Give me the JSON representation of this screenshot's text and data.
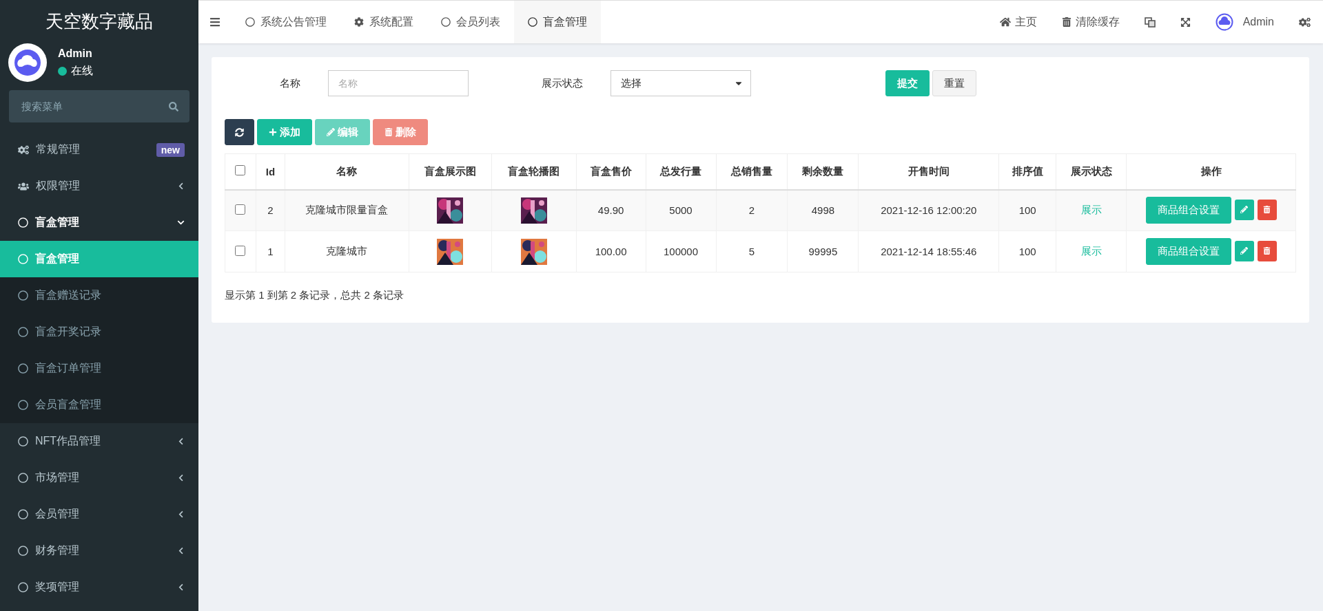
{
  "brand": "天空数字藏品",
  "user": {
    "name": "Admin",
    "status": "在线",
    "online": true
  },
  "menu_search": {
    "placeholder": "搜索菜单"
  },
  "menu": [
    {
      "label": "常规管理",
      "kind": "gears",
      "badge": "new"
    },
    {
      "label": "权限管理",
      "kind": "users",
      "expanded": false
    },
    {
      "label": "盲盒管理",
      "kind": "circle",
      "expanded": true,
      "children": [
        {
          "label": "盲盒管理",
          "selected": true
        },
        {
          "label": "盲盒赠送记录",
          "selected": false
        },
        {
          "label": "盲盒开奖记录",
          "selected": false
        },
        {
          "label": "盲盒订单管理",
          "selected": false
        },
        {
          "label": "会员盲盒管理",
          "selected": false
        }
      ]
    },
    {
      "label": "NFT作品管理",
      "kind": "circle",
      "expanded": false
    },
    {
      "label": "市场管理",
      "kind": "circle",
      "expanded": false
    },
    {
      "label": "会员管理",
      "kind": "circle",
      "expanded": false
    },
    {
      "label": "财务管理",
      "kind": "circle",
      "expanded": false
    },
    {
      "label": "奖项管理",
      "kind": "circle",
      "expanded": false
    }
  ],
  "tabs": [
    {
      "label": "系统公告管理",
      "kind": "circle",
      "selected": false
    },
    {
      "label": "系统配置",
      "kind": "gear",
      "selected": false
    },
    {
      "label": "会员列表",
      "kind": "circle",
      "selected": false
    },
    {
      "label": "盲盒管理",
      "kind": "circle",
      "selected": true
    }
  ],
  "top_actions": [
    {
      "kind": "home",
      "label": "主页"
    },
    {
      "kind": "trash",
      "label": "清除缓存"
    },
    {
      "kind": "translate"
    },
    {
      "kind": "fullscreen"
    },
    {
      "kind": "user",
      "label": "Admin"
    },
    {
      "kind": "settings"
    }
  ],
  "filter": {
    "name_label": "名称",
    "name_placeholder": "名称",
    "status_label": "展示状态",
    "status_value": "选择",
    "buttons": [
      {
        "label": "提交",
        "kind": "primary"
      },
      {
        "label": "重置",
        "kind": "default"
      }
    ]
  },
  "toolbar": [
    {
      "kind": "refresh",
      "disabled": false
    },
    {
      "kind": "add",
      "label": "添加",
      "disabled": false
    },
    {
      "kind": "edit",
      "label": "编辑",
      "disabled": true
    },
    {
      "kind": "delete",
      "label": "删除",
      "disabled": true
    }
  ],
  "table": {
    "select_all_checked": false,
    "columns": [
      "Id",
      "名称",
      "盲盒展示图",
      "盲盒轮播图",
      "盲盒售价",
      "总发行量",
      "总销售量",
      "剩余数量",
      "开售时间",
      "排序值",
      "展示状态",
      "操作"
    ],
    "rows": [
      {
        "checked": false,
        "id": "2",
        "name": "克隆城市限量盲盒",
        "price": "49.90",
        "issued": "5000",
        "sold": "2",
        "remaining": "4998",
        "sale_time": "2021-12-16 12:00:20",
        "sort": "100",
        "status": "展示",
        "action": "商品组合设置"
      },
      {
        "checked": false,
        "id": "1",
        "name": "克隆城市",
        "price": "100.00",
        "issued": "100000",
        "sold": "5",
        "remaining": "99995",
        "sale_time": "2021-12-14 18:55:46",
        "sort": "100",
        "status": "展示",
        "action": "商品组合设置"
      }
    ]
  },
  "pagination_info": "显示第 1 到第 2 条记录，总共 2 条记录"
}
